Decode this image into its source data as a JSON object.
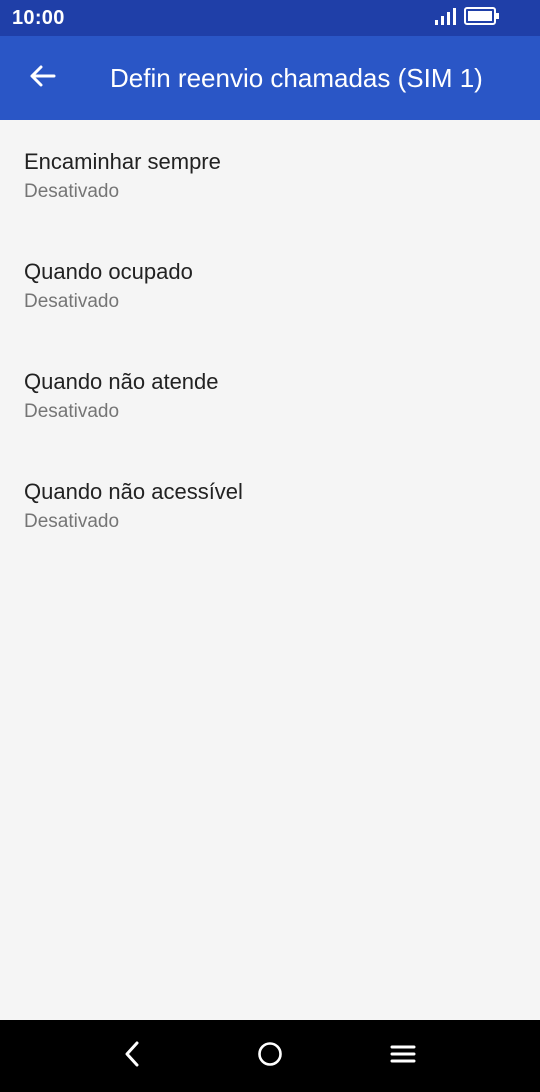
{
  "status_bar": {
    "time": "10:00",
    "icons": [
      "signal-icon",
      "battery-icon"
    ]
  },
  "app_bar": {
    "title": "Defin reenvio chamadas (SIM 1)",
    "back_icon": "arrow-left-icon"
  },
  "items": [
    {
      "title": "Encaminhar sempre",
      "subtitle": "Desativado"
    },
    {
      "title": "Quando ocupado",
      "subtitle": "Desativado"
    },
    {
      "title": "Quando não atende",
      "subtitle": "Desativado"
    },
    {
      "title": "Quando não acessível",
      "subtitle": "Desativado"
    }
  ],
  "nav_bar": {
    "icons": [
      "nav-back-icon",
      "nav-home-icon",
      "nav-menu-icon"
    ]
  },
  "colors": {
    "status_bar": "#1f3fa8",
    "app_bar": "#2a56c6",
    "background": "#f5f5f5",
    "nav_bar": "#000000"
  }
}
